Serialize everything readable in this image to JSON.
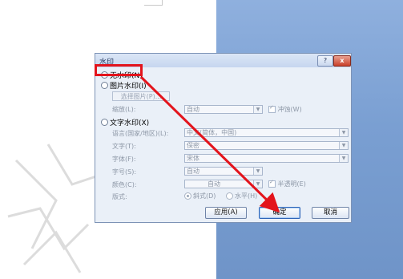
{
  "dialog": {
    "title": "水印",
    "help_label": "?",
    "close_label": "x",
    "no_watermark_label": "无水印(N)",
    "picture_watermark_label": "图片水印(I)",
    "select_picture_label": "选择图片(P)...",
    "scale_label": "缩放(L):",
    "scale_value": "自动",
    "washout_label": "冲蚀(W)",
    "text_watermark_label": "文字水印(X)",
    "language_label": "语言(国家/地区)(L):",
    "language_value": "中文(简体，中国)",
    "text_label": "文字(T):",
    "text_value": "保密",
    "font_label": "字体(F):",
    "font_value": "宋体",
    "size_label": "字号(S):",
    "size_value": "自动",
    "color_label": "颜色(C):",
    "color_value": "自动",
    "semitransparent_label": "半透明(E)",
    "layout_label": "版式:",
    "diagonal_label": "斜式(D)",
    "horizontal_label": "水平(H)",
    "apply_label": "应用(A)",
    "ok_label": "确定",
    "cancel_label": "取消"
  },
  "annotation_colors": {
    "highlight": "#e3141c",
    "arrow": "#e3141c"
  },
  "icons": {
    "help": "question-icon",
    "close": "close-icon",
    "dropdown": "chevron-down-icon"
  }
}
